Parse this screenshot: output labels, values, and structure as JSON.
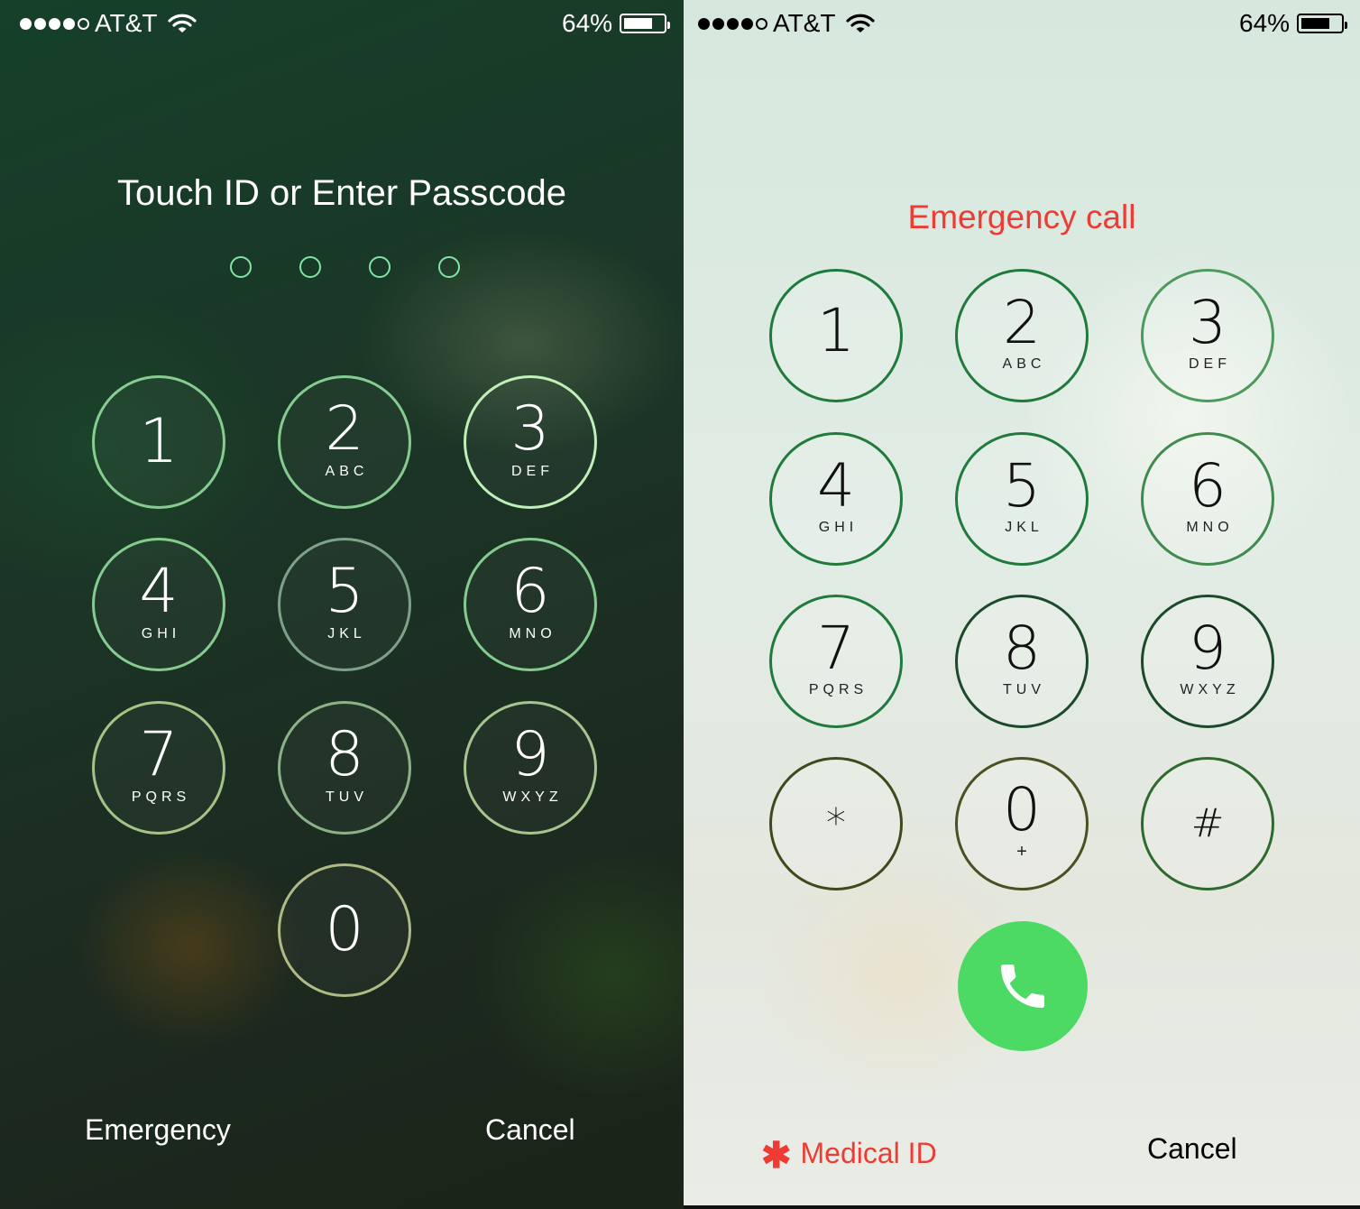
{
  "left": {
    "status": {
      "carrier": "AT&T",
      "signal_bars": 4,
      "battery": "64%"
    },
    "title": "Touch ID or Enter Passcode",
    "passcode_digits": 4,
    "keys": [
      {
        "num": "1",
        "letters": ""
      },
      {
        "num": "2",
        "letters": "ABC"
      },
      {
        "num": "3",
        "letters": "DEF"
      },
      {
        "num": "4",
        "letters": "GHI"
      },
      {
        "num": "5",
        "letters": "JKL"
      },
      {
        "num": "6",
        "letters": "MNO"
      },
      {
        "num": "7",
        "letters": "PQRS"
      },
      {
        "num": "8",
        "letters": "TUV"
      },
      {
        "num": "9",
        "letters": "WXYZ"
      },
      {
        "num": "0",
        "letters": ""
      }
    ],
    "emergency_label": "Emergency",
    "cancel_label": "Cancel"
  },
  "right": {
    "status": {
      "carrier": "AT&T",
      "signal_bars": 4,
      "battery": "64%"
    },
    "title": "Emergency call",
    "keys": [
      {
        "num": "1",
        "letters": ""
      },
      {
        "num": "2",
        "letters": "ABC"
      },
      {
        "num": "3",
        "letters": "DEF"
      },
      {
        "num": "4",
        "letters": "GHI"
      },
      {
        "num": "5",
        "letters": "JKL"
      },
      {
        "num": "6",
        "letters": "MNO"
      },
      {
        "num": "7",
        "letters": "PQRS"
      },
      {
        "num": "8",
        "letters": "TUV"
      },
      {
        "num": "9",
        "letters": "WXYZ"
      },
      {
        "num": "*",
        "letters": ""
      },
      {
        "num": "0",
        "letters": "+"
      },
      {
        "num": "#",
        "letters": ""
      }
    ],
    "call_icon": "phone-icon",
    "medical_asterisk": "✱",
    "medical_label": "Medical ID",
    "cancel_label": "Cancel"
  },
  "colors": {
    "accent_red": "#ee3b33",
    "call_green": "#4cd964",
    "pin_dot": "#7fe6a6"
  }
}
